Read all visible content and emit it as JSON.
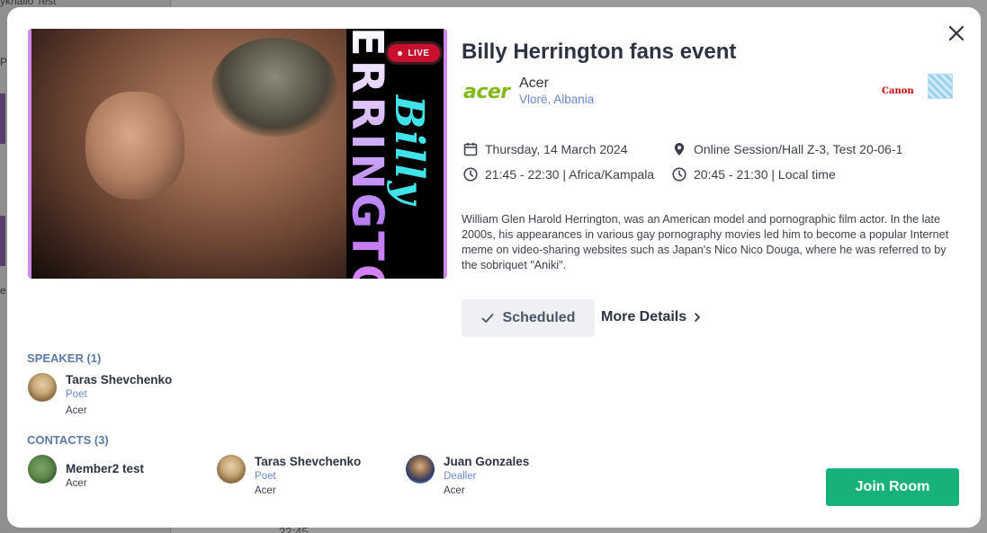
{
  "background": {
    "item1": "ykhailo Test",
    "item2": "Pr",
    "item3": "e",
    "time": "22:45"
  },
  "event": {
    "title": "Billy Herrington fans event",
    "live_badge": "LIVE",
    "hero_text_vertical": "ERRINGTO",
    "hero_script": "Billy",
    "organizer": {
      "logo_text": "acer",
      "name": "Acer",
      "location": "Vlorë, Albania"
    },
    "sponsors": [
      "Canon"
    ],
    "date": "Thursday, 14 March 2024",
    "location": "Online Session/Hall Z-3, Test 20-06-1",
    "time_event": "21:45 - 22:30 | Africa/Kampala",
    "time_local": "20:45 - 21:30 | Local time",
    "description": "William Glen Harold Herrington, was an American model and pornographic film actor. In the late 2000s, his appearances in various gay pornography movies led him to become a popular Internet meme on video-sharing websites such as Japan's Nico Nico Douga, where he was referred to by the sobriquet \"Aniki\".",
    "status_label": "Scheduled",
    "more_details_label": "More Details"
  },
  "speakers": {
    "label": "SPEAKER (1)",
    "items": [
      {
        "name": "Taras Shevchenko",
        "role": "Poet",
        "org": "Acer"
      }
    ]
  },
  "contacts": {
    "label": "CONTACTS (3)",
    "items": [
      {
        "name": "Member2 test",
        "role": "",
        "org": "Acer"
      },
      {
        "name": "Taras Shevchenko",
        "role": "Poet",
        "org": "Acer"
      },
      {
        "name": "Juan Gonzales",
        "role": "Dealler",
        "org": "Acer"
      }
    ]
  },
  "actions": {
    "join_label": "Join Room"
  },
  "colors": {
    "join": "#16b27a",
    "link": "#6b87c9",
    "section": "#5b7aa8",
    "live": "#c8102e"
  }
}
